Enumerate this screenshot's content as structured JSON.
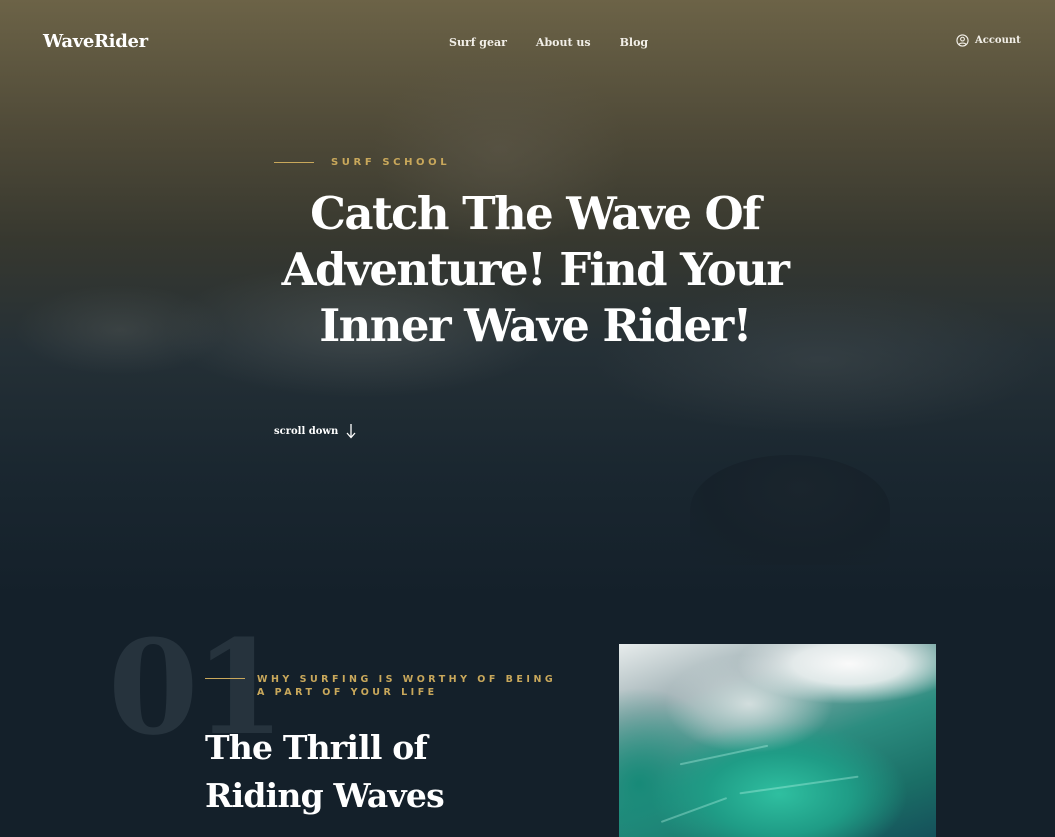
{
  "nav": {
    "logo": "WaveRider",
    "links": [
      "Surf gear",
      "About us",
      "Blog"
    ],
    "account_label": "Account"
  },
  "hero": {
    "eyebrow": "SURF SCHOOL",
    "headline": "Catch The Wave Of Adventure! Find Your Inner Wave Rider!",
    "scroll_label": "scroll down"
  },
  "section": {
    "number": "01",
    "eyebrow": "WHY SURFING IS WORTHY OF BEING A PART OF YOUR LIFE",
    "title": "The Thrill of Riding Waves"
  },
  "colors": {
    "accent": "#c9a85b",
    "background": "#14202a",
    "number_text": "#26333d"
  },
  "icons": {
    "account": "user-circle-icon",
    "scroll": "arrow-down-icon"
  }
}
